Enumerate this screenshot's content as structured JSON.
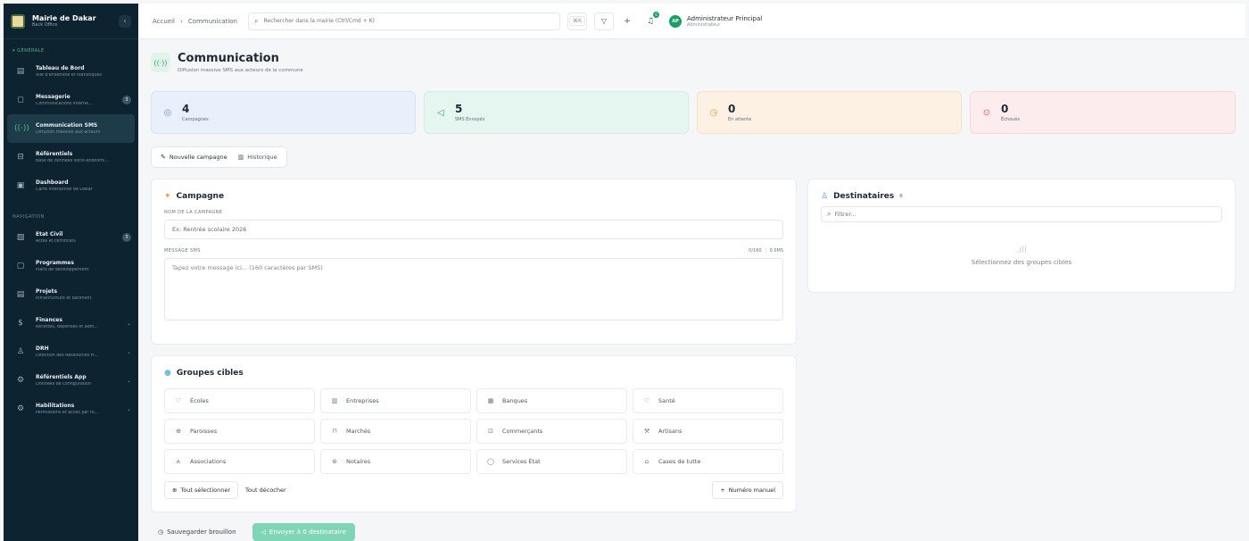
{
  "brand": {
    "title": "Mairie de Dakar",
    "subtitle": "Back Office",
    "collapse_icon": "‹"
  },
  "sidebar": {
    "section_general": "▾ GÉNÉRALE",
    "section_nav": "NAVIGATION",
    "items": [
      {
        "label": "Tableau de Bord",
        "desc": "Vue d'ensemble et statistiques",
        "icon": "chart-icon",
        "glyph": "▤"
      },
      {
        "label": "Messagerie",
        "desc": "Communications interne...",
        "icon": "message-icon",
        "glyph": "◻",
        "badge": "3"
      },
      {
        "label": "Communication SMS",
        "desc": "Diffusion massive aux acteurs",
        "icon": "broadcast-icon",
        "glyph": "((·))",
        "active": true
      },
      {
        "label": "Référentiels",
        "desc": "Base de données socio-économi...",
        "icon": "database-icon",
        "glyph": "⊟"
      },
      {
        "label": "Dashboard",
        "desc": "Carte interactive de Dakar",
        "icon": "map-icon",
        "glyph": "▣"
      }
    ],
    "nav_items": [
      {
        "label": "État Civil",
        "desc": "Actes et certificats",
        "icon": "document-icon",
        "glyph": "▧",
        "badge": "3"
      },
      {
        "label": "Programmes",
        "desc": "Plans de développement",
        "icon": "folder-icon",
        "glyph": "▢"
      },
      {
        "label": "Projets",
        "desc": "Infrastructure et bâtiment",
        "icon": "clipboard-icon",
        "glyph": "▤"
      },
      {
        "label": "Finances",
        "desc": "Recettes, dépenses et adm...",
        "icon": "dollar-icon",
        "glyph": "$",
        "chevron": "⌄"
      },
      {
        "label": "DRH",
        "desc": "Direction des Ressources H...",
        "icon": "users-icon",
        "glyph": "♙",
        "chevron": "⌄"
      },
      {
        "label": "Référentiels App",
        "desc": "Données de configuration",
        "icon": "settings-icon",
        "glyph": "⚙",
        "chevron": "⌄"
      },
      {
        "label": "Habilitations",
        "desc": "Permissions et accès par rô...",
        "icon": "key-icon",
        "glyph": "⚙",
        "chevron": "⌄"
      }
    ]
  },
  "topbar": {
    "breadcrumb_home": "Accueil",
    "breadcrumb_sep": "›",
    "breadcrumb_current": "Communication",
    "search_placeholder": "Rechercher dans la mairie (Ctrl/Cmd + K)",
    "kbd": "⌘K",
    "notif_count": "0",
    "user_initials": "AP",
    "user_name": "Administrateur Principal",
    "user_role": "Administrateur"
  },
  "page": {
    "icon_glyph": "((·))",
    "title": "Communication",
    "subtitle": "Diffusion massive SMS aux acteurs de la commune"
  },
  "stats": [
    {
      "value": "4",
      "label": "Campagnes",
      "icon": "layers-icon",
      "glyph": "◎"
    },
    {
      "value": "5",
      "label": "SMS Envoyés",
      "icon": "send-icon",
      "glyph": "◁"
    },
    {
      "value": "0",
      "label": "En attente",
      "icon": "clock-icon",
      "glyph": "◷"
    },
    {
      "value": "0",
      "label": "Échoués",
      "icon": "alert-icon",
      "glyph": "⊙"
    }
  ],
  "tabs": [
    {
      "label": "Nouvelle campagne",
      "glyph": "✎"
    },
    {
      "label": "Historique",
      "glyph": "▥"
    }
  ],
  "campaign": {
    "title": "Campagne",
    "title_glyph": "✦",
    "name_label": "NOM DE LA CAMPAGNE",
    "name_value": "Ex: Rentrée scolaire 2026",
    "message_label": "MESSAGE SMS",
    "char_count": "0/160",
    "sms_count": "0 SMS",
    "message_placeholder": "Tapez votre message ici... (160 caractères par SMS)"
  },
  "destinataires": {
    "title": "Destinataires",
    "title_glyph": "♙",
    "count": "0",
    "filter_placeholder": "Filtrer...",
    "empty_glyph": ".ıll",
    "empty_text": "Sélectionnez des groupes cibles"
  },
  "groups": {
    "title": "Groupes cibles",
    "title_glyph": "●",
    "items": [
      {
        "label": "Écoles",
        "icon": "school-icon",
        "glyph": "♡"
      },
      {
        "label": "Entreprises",
        "icon": "building-icon",
        "glyph": "▥"
      },
      {
        "label": "Banques",
        "icon": "bank-icon",
        "glyph": "▦"
      },
      {
        "label": "Santé",
        "icon": "heart-icon",
        "glyph": "♡"
      },
      {
        "label": "Paroisses",
        "icon": "church-icon",
        "glyph": "⊕"
      },
      {
        "label": "Marchés",
        "icon": "market-icon",
        "glyph": "⊓"
      },
      {
        "label": "Commerçants",
        "icon": "shop-icon",
        "glyph": "⊡"
      },
      {
        "label": "Artisans",
        "icon": "tool-icon",
        "glyph": "⚒"
      },
      {
        "label": "Associations",
        "icon": "group-icon",
        "glyph": "ጰ"
      },
      {
        "label": "Notaires",
        "icon": "notary-icon",
        "glyph": "⊛"
      },
      {
        "label": "Services État",
        "icon": "government-icon",
        "glyph": "◯"
      },
      {
        "label": "Cases de tutte",
        "icon": "home-icon",
        "glyph": "⌂"
      }
    ],
    "select_all": "Tout sélectionner",
    "select_all_glyph": "⊕",
    "deselect_all": "Tout décocher",
    "manual_number": "Numéro manuel",
    "manual_glyph": "+"
  },
  "footer": {
    "save_draft": "Sauvegarder brouillon",
    "save_glyph": "◷",
    "send": "Envoyer à 0 destinataire",
    "send_glyph": "◁"
  }
}
